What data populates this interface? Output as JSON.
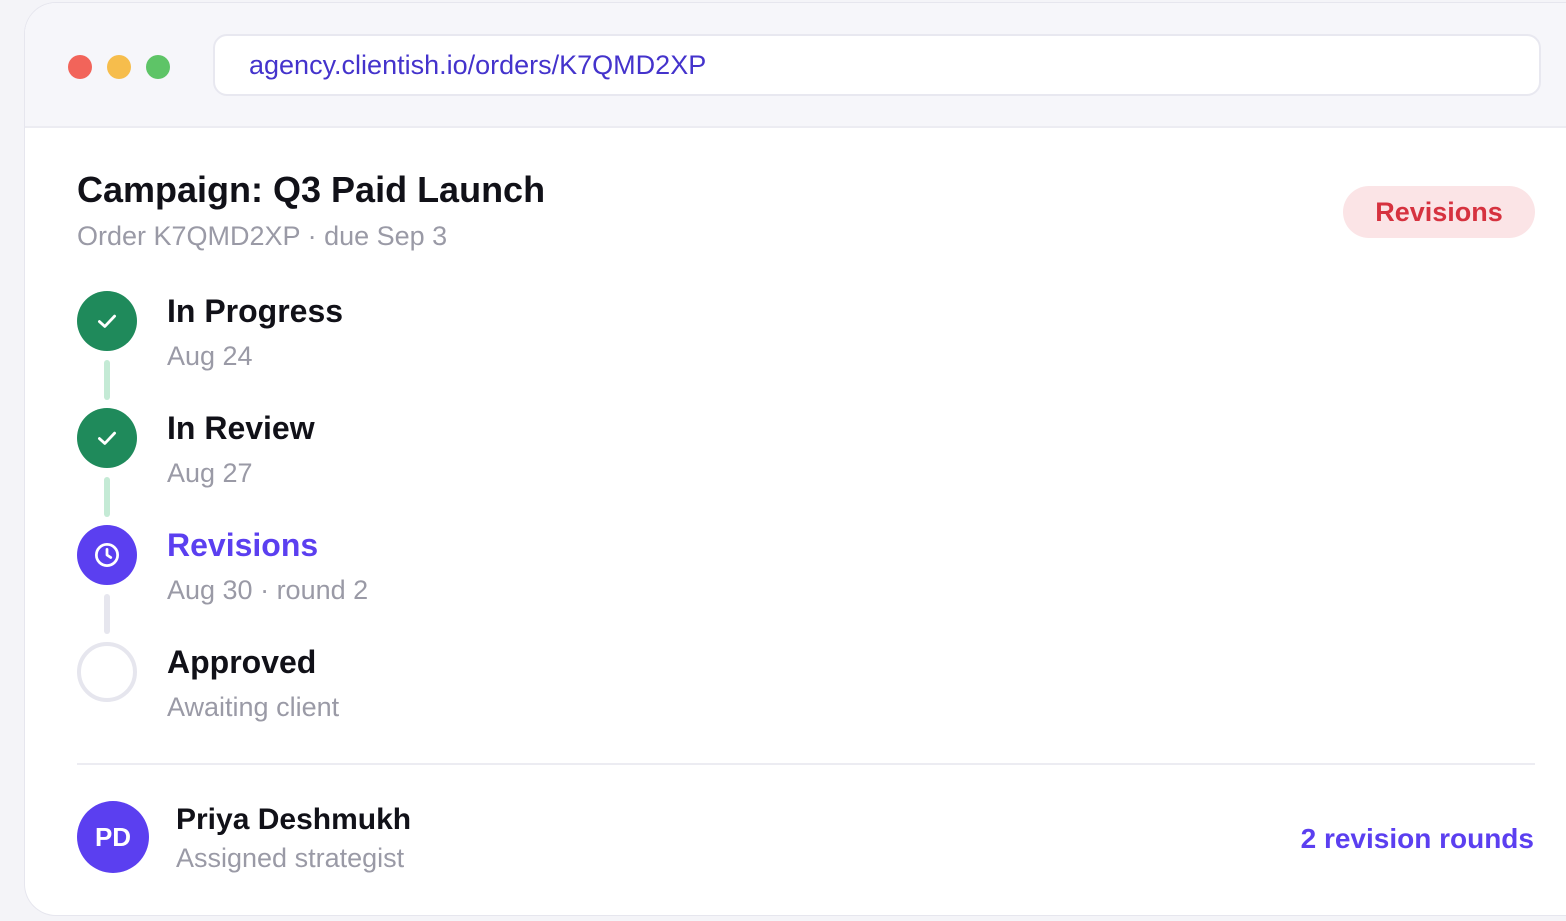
{
  "colors": {
    "accent": "#5b3ff0",
    "done": "#1f8a5b",
    "done_line": "#c4ead5",
    "pending_line": "#e6e6ee",
    "badge_bg": "#fbe4e6",
    "badge_text": "#d6323f",
    "dot_red": "#f2645a",
    "dot_yellow": "#f6bd4c",
    "dot_green": "#5ec467"
  },
  "browser": {
    "url": "agency.clientish.io/orders/K7QMD2XP"
  },
  "order": {
    "title": "Campaign: Q3 Paid Launch",
    "subtitle": "Order K7QMD2XP · due Sep 3",
    "status_badge": "Revisions"
  },
  "timeline": [
    {
      "label": "In Progress",
      "meta": "Aug 24",
      "state": "done",
      "icon": "check-icon"
    },
    {
      "label": "In Review",
      "meta": "Aug 27",
      "state": "done",
      "icon": "check-icon"
    },
    {
      "label": "Revisions",
      "meta": "Aug 30 · round 2",
      "state": "current",
      "icon": "clock-icon"
    },
    {
      "label": "Approved",
      "meta": "Awaiting client",
      "state": "pending",
      "icon": "empty-circle-icon"
    }
  ],
  "assignee": {
    "initials": "PD",
    "name": "Priya Deshmukh",
    "role": "Assigned strategist"
  },
  "revision_rounds": "2 revision rounds"
}
